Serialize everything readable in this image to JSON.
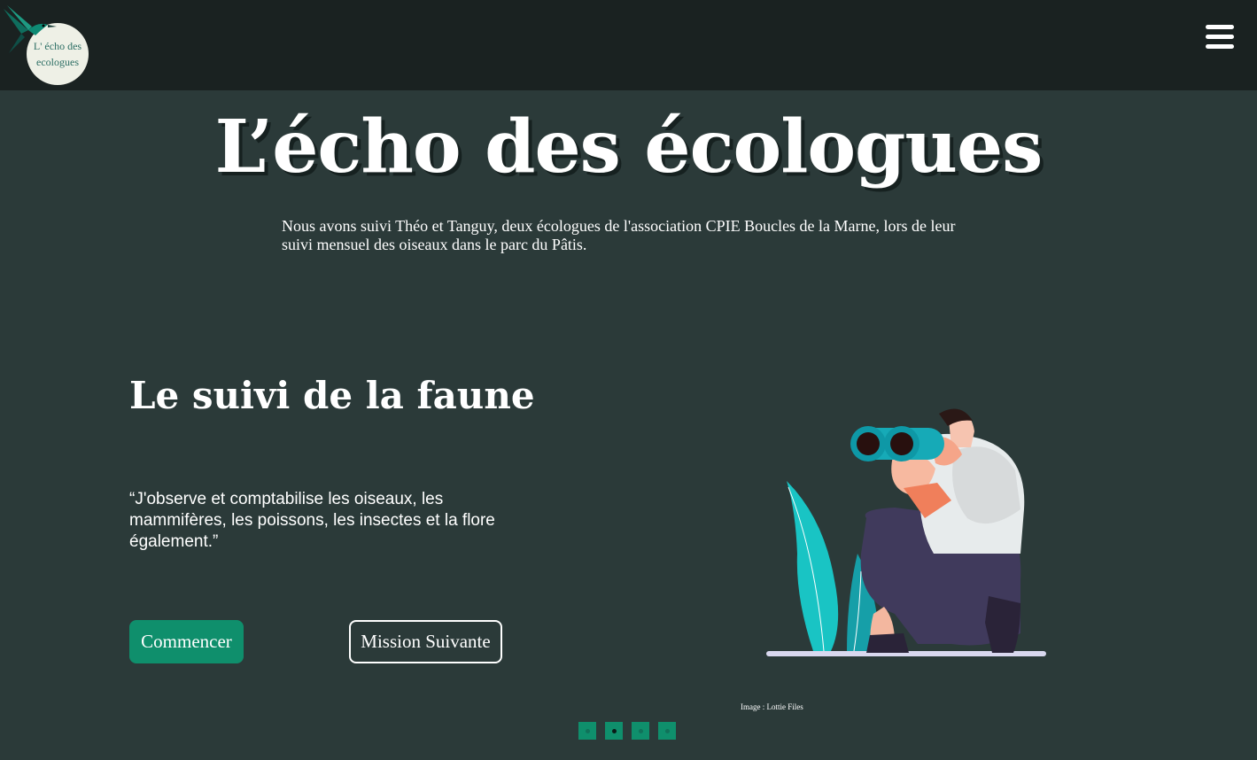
{
  "header": {
    "logo_text_line1": "L' écho des",
    "logo_text_line2": "ecologues",
    "menu_icon": "hamburger-menu-icon"
  },
  "hero": {
    "title": "L’écho des écologues",
    "subtitle": "Nous avons suivi Théo et Tanguy, deux écologues de l'association CPIE Boucles de la Marne, lors de leur suivi mensuel des oiseaux dans le parc du Pâtis."
  },
  "section": {
    "title": "Le suivi de la faune",
    "quote": "“J'observe et comptabilise les oiseaux, les mammifères, les poissons, les insectes et la flore également.”",
    "start_label": "Commencer",
    "next_label": "Mission Suivante",
    "illustration_icon": "person-with-binoculars-illustration",
    "credit": "Image : Lottie Files"
  },
  "pagination": {
    "count": 4,
    "active_index": 1
  },
  "colors": {
    "background": "#2b3a39",
    "header": "#1a2221",
    "accent": "#0f8f6c",
    "text": "#ffffff"
  }
}
